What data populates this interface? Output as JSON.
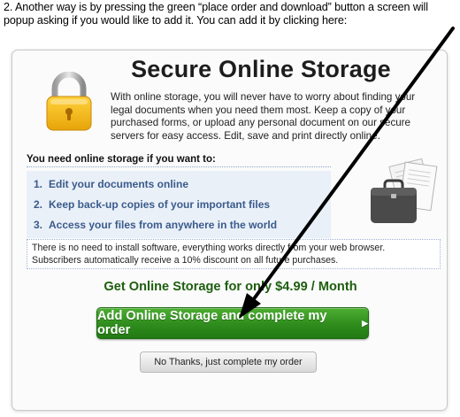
{
  "caption": "2. Another way is by pressing the green “place order and download” button a screen will popup asking if you would like to add it. You can add it by clicking here:",
  "panel": {
    "title": "Secure Online Storage",
    "description": "With online storage, you will never have to worry about finding your legal documents when you need them most. Keep a copy of your purchased forms, or upload any personal document on our secure servers for easy access. Edit, save and print directly online.",
    "want_heading": "You need online storage if you want to:",
    "list": [
      {
        "num": "1.",
        "text": "Edit your documents online"
      },
      {
        "num": "2.",
        "text": "Keep back-up copies of your important files"
      },
      {
        "num": "3.",
        "text": "Access your files from anywhere in the world"
      }
    ],
    "info_line1": "There is no need to install software, everything works directly from your web browser.",
    "info_line2": "Subscribers automatically receive a 10% discount on all future purchases.",
    "offer": "Get Online Storage for only $4.99 / Month",
    "add_button": "Add Online Storage and complete my order",
    "add_button_arrow": "▶",
    "no_button": "No Thanks, just complete my order"
  },
  "colors": {
    "accent_green": "#2f8c1d",
    "offer_green": "#1e5e0e",
    "list_blue": "#3a5b8c"
  },
  "icons": [
    "padlock-icon",
    "briefcase-icon",
    "annotation-arrow"
  ]
}
